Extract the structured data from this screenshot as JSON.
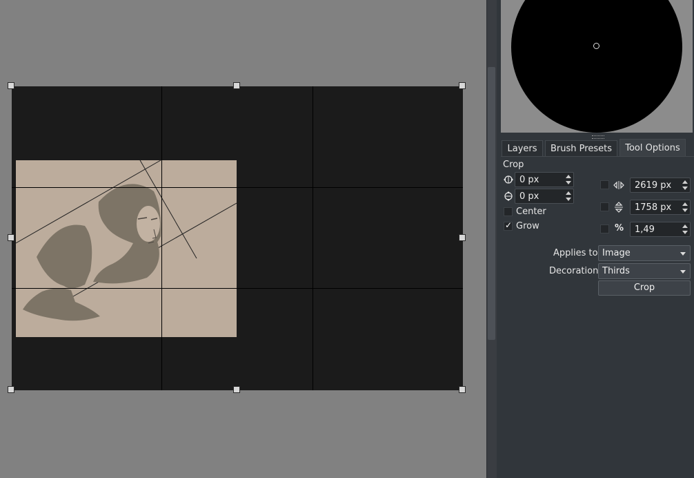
{
  "tabs": [
    {
      "label": "Layers"
    },
    {
      "label": "Brush Presets"
    },
    {
      "label": "Tool Options"
    }
  ],
  "tool_options": {
    "section_title": "Crop",
    "x_value": "0 px",
    "y_value": "0 px",
    "center_label": "Center",
    "center_checked": false,
    "grow_label": "Grow",
    "grow_checked": true,
    "width_value": "2619 px",
    "height_value": "1758 px",
    "ratio_symbol": "%",
    "ratio_value": "1,49",
    "applies_to_label": "Applies to:",
    "applies_to_value": "Image",
    "decoration_label": "Decoration:",
    "decoration_value": "Thirds",
    "crop_button": "Crop"
  },
  "icons": {
    "horizontal_offset": "horizontal-arrows-icon",
    "vertical_offset": "vertical-arrows-icon",
    "width": "width-arrows-icon",
    "height": "height-arrows-icon"
  },
  "colors": {
    "canvas_bg": "#818181",
    "crop_frame": "#1b1b1b",
    "image_paper": "#bcac9c",
    "panel_bg": "#31363b"
  }
}
